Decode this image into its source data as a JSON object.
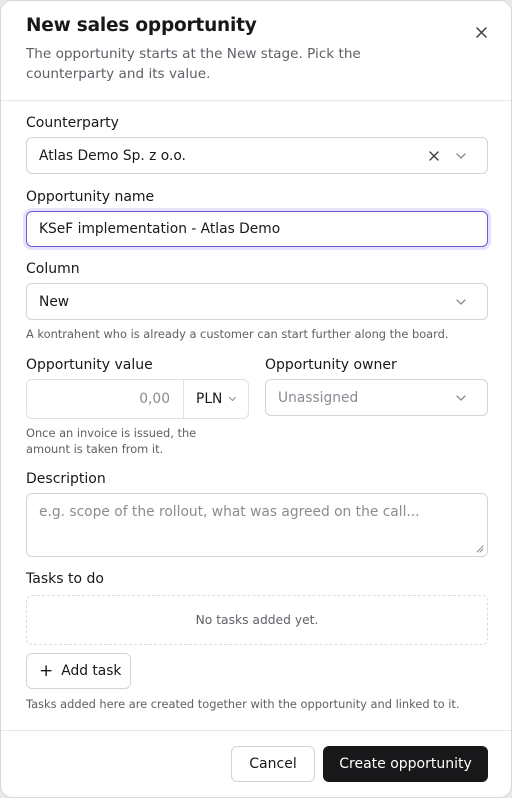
{
  "header": {
    "title": "New sales opportunity",
    "subtitle": "The opportunity starts at the New stage. Pick the counterparty and its value.",
    "close_icon": "close-icon"
  },
  "counterparty": {
    "label": "Counterparty",
    "value": "Atlas Demo Sp. z o.o.",
    "clear_icon": "clear-icon",
    "chevron_icon": "chevron-down-icon"
  },
  "opportunity_name": {
    "label": "Opportunity name",
    "value": "KSeF implementation - Atlas Demo"
  },
  "column": {
    "label": "Column",
    "value": "New",
    "help": "A kontrahent who is already a customer can start further along the board."
  },
  "opportunity_value": {
    "label": "Opportunity value",
    "placeholder": "0,00",
    "currency": "PLN",
    "help_line1": "Once an invoice is issued, the",
    "help_line2": "amount is taken from it."
  },
  "opportunity_owner": {
    "label": "Opportunity owner",
    "value": "Unassigned"
  },
  "description": {
    "label": "Description",
    "placeholder": "e.g. scope of the rollout, what was agreed on the call..."
  },
  "tasks": {
    "label": "Tasks to do",
    "empty_text": "No tasks added yet.",
    "add_label": "Add task",
    "help": "Tasks added here are created together with the opportunity and linked to it."
  },
  "footer": {
    "cancel_label": "Cancel",
    "create_label": "Create opportunity"
  },
  "colors": {
    "primary_button": "#18181b",
    "focus_ring": "#6b5bd6"
  }
}
